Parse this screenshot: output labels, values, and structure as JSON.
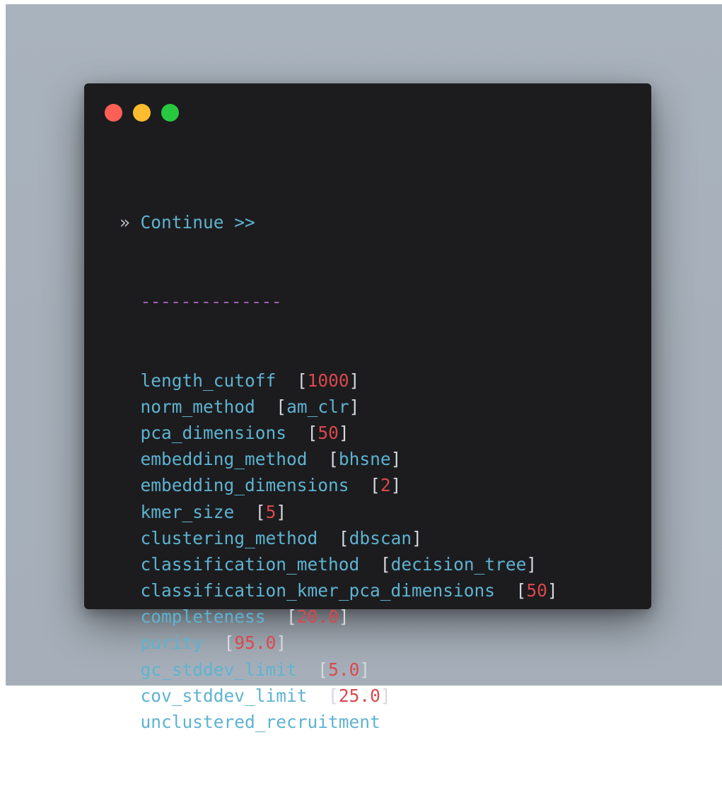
{
  "colors": {
    "window_bg": "#1c1c1e",
    "traffic_red": "#fe5f57",
    "traffic_yellow": "#febc2e",
    "traffic_green": "#28c840",
    "text_cyan": "#5eb3d1",
    "number_red": "#d9484e",
    "separator_purple": "#a35fb5"
  },
  "terminal": {
    "prompt_symbol": "»",
    "heading": "Continue >>",
    "separator": "--------------",
    "options": [
      {
        "name": "length_cutoff",
        "gap": "  ",
        "value": "1000",
        "value_type": "number"
      },
      {
        "name": "norm_method",
        "gap": "  ",
        "value": "am_clr",
        "value_type": "string"
      },
      {
        "name": "pca_dimensions",
        "gap": "  ",
        "value": "50",
        "value_type": "number"
      },
      {
        "name": "embedding_method",
        "gap": "  ",
        "value": "bhsne",
        "value_type": "string"
      },
      {
        "name": "embedding_dimensions",
        "gap": "  ",
        "value": "2",
        "value_type": "number"
      },
      {
        "name": "kmer_size",
        "gap": "  ",
        "value": "5",
        "value_type": "number"
      },
      {
        "name": "clustering_method",
        "gap": "  ",
        "value": "dbscan",
        "value_type": "string"
      },
      {
        "name": "classification_method",
        "gap": "  ",
        "value": "decision_tree",
        "value_type": "string"
      },
      {
        "name": "classification_kmer_pca_dimensions",
        "gap": "  ",
        "value": "50",
        "value_type": "number"
      },
      {
        "name": "completeness",
        "gap": "  ",
        "value": "20.0",
        "value_type": "number"
      },
      {
        "name": "purity",
        "gap": "  ",
        "value": "95.0",
        "value_type": "number"
      },
      {
        "name": "gc_stddev_limit",
        "gap": "  ",
        "value": "5.0",
        "value_type": "number"
      },
      {
        "name": "cov_stddev_limit",
        "gap": "  ",
        "value": "25.0",
        "value_type": "number"
      },
      {
        "name": "unclustered_recruitment",
        "gap": "",
        "value": null,
        "value_type": "none"
      }
    ]
  }
}
